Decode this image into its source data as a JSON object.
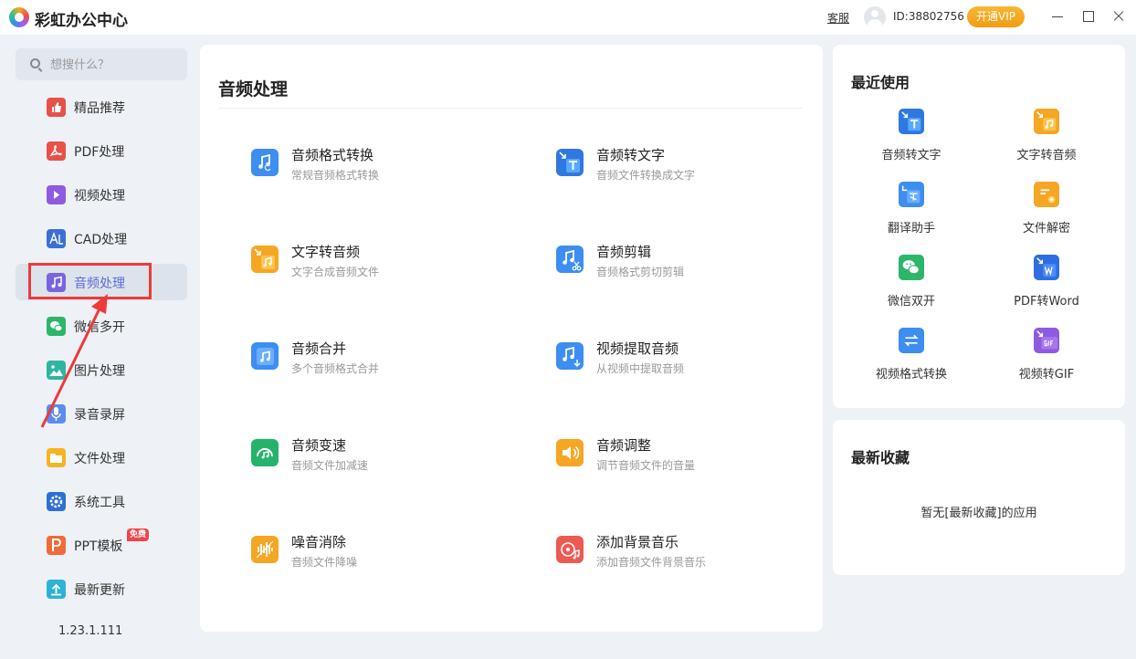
{
  "titlebar": {
    "app_title": "彩虹办公中心",
    "kefu": "客服",
    "user_id": "ID:38802756",
    "vip": "开通VIP"
  },
  "search": {
    "placeholder": "想搜什么？"
  },
  "sidebar": {
    "items": [
      {
        "label": "精品推荐",
        "icon": "thumbs-up-icon",
        "color": "#e8504a"
      },
      {
        "label": "PDF处理",
        "icon": "pdf-icon",
        "color": "#e8504a"
      },
      {
        "label": "视频处理",
        "icon": "play-icon",
        "color": "#8e5be0"
      },
      {
        "label": "CAD处理",
        "icon": "cad-icon",
        "color": "#3a6fd8"
      },
      {
        "label": "音频处理",
        "icon": "music-note-icon",
        "color": "#7b63e0"
      },
      {
        "label": "微信多开",
        "icon": "wechat-icon",
        "color": "#2cb66a"
      },
      {
        "label": "图片处理",
        "icon": "image-icon",
        "color": "#2cb6a0"
      },
      {
        "label": "录音录屏",
        "icon": "microphone-icon",
        "color": "#5b8cf0"
      },
      {
        "label": "文件处理",
        "icon": "folder-icon",
        "color": "#f5b425"
      },
      {
        "label": "系统工具",
        "icon": "gear-icon",
        "color": "#2e6fd6"
      },
      {
        "label": "PPT模板",
        "icon": "ppt-icon",
        "color": "#ef6b3a",
        "badge": "免费"
      },
      {
        "label": "最新更新",
        "icon": "upload-icon",
        "color": "#2fb2d8"
      }
    ],
    "version": "1.23.1.111"
  },
  "main": {
    "title": "音频处理",
    "features": [
      {
        "title": "音频格式转换",
        "sub": "常规音频格式转换",
        "icon": "audio-convert-icon",
        "color": "#3d8ef0"
      },
      {
        "title": "音频转文字",
        "sub": "音频文件转换成文字",
        "icon": "audio-to-text-icon",
        "color": "#2f78e0"
      },
      {
        "title": "文字转音频",
        "sub": "文字合成音频文件",
        "icon": "text-to-audio-icon",
        "color": "#f5a623"
      },
      {
        "title": "音频剪辑",
        "sub": "音频格式剪切剪辑",
        "icon": "audio-cut-icon",
        "color": "#3d8ef0"
      },
      {
        "title": "音频合并",
        "sub": "多个音频格式合并",
        "icon": "audio-merge-icon",
        "color": "#3d8ef0"
      },
      {
        "title": "视频提取音频",
        "sub": "从视频中提取音频",
        "icon": "video-extract-audio-icon",
        "color": "#3d8ef0"
      },
      {
        "title": "音频变速",
        "sub": "音频文件加减速",
        "icon": "audio-speed-icon",
        "color": "#25b36c"
      },
      {
        "title": "音频调整",
        "sub": "调节音频文件的音量",
        "icon": "volume-icon",
        "color": "#f5a623"
      },
      {
        "title": "噪音消除",
        "sub": "音频文件降噪",
        "icon": "noise-removal-icon",
        "color": "#f5a623"
      },
      {
        "title": "添加背景音乐",
        "sub": "添加音频文件背景音乐",
        "icon": "background-music-icon",
        "color": "#ec5a52"
      }
    ]
  },
  "recent": {
    "title": "最近使用",
    "items": [
      {
        "label": "音频转文字",
        "icon": "audio-to-text-icon",
        "color": "#2f78e0"
      },
      {
        "label": "文字转音频",
        "icon": "text-to-audio-icon",
        "color": "#f5a623"
      },
      {
        "label": "翻译助手",
        "icon": "translate-icon",
        "color": "#3d8ef0"
      },
      {
        "label": "文件解密",
        "icon": "file-decrypt-icon",
        "color": "#f5a623"
      },
      {
        "label": "微信双开",
        "icon": "wechat-icon",
        "color": "#2cb66a"
      },
      {
        "label": "PDF转Word",
        "icon": "pdf-to-word-icon",
        "color": "#2f6ee0"
      },
      {
        "label": "视频格式转换",
        "icon": "video-convert-icon",
        "color": "#3d8ef0"
      },
      {
        "label": "视频转GIF",
        "icon": "video-to-gif-icon",
        "color": "#8e5be0"
      }
    ]
  },
  "favorites": {
    "title": "最新收藏",
    "empty": "暂无[最新收藏]的应用"
  }
}
